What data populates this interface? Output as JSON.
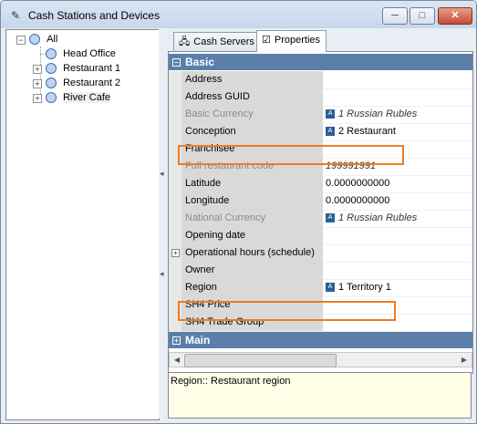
{
  "window": {
    "title": "Cash Stations and Devices",
    "controls": {
      "minimize": "─",
      "maximize": "□",
      "close": "✕"
    }
  },
  "tree": {
    "root": "All",
    "items": [
      "Head Office",
      "Restaurant 1",
      "Restaurant 2",
      "River Cafe"
    ]
  },
  "tabs": [
    {
      "label": "Cash Servers",
      "icon": "server-icon"
    },
    {
      "label": "Properties",
      "icon": "properties-icon"
    }
  ],
  "categories": {
    "basic": "Basic",
    "main": "Main"
  },
  "properties": [
    {
      "name": "Address",
      "value": "",
      "disabled": false
    },
    {
      "name": "Address GUID",
      "value": "",
      "disabled": false
    },
    {
      "name": "Basic Currency",
      "value": "1 Russian Rubles",
      "disabled": true,
      "icon": true,
      "italic": true
    },
    {
      "name": "Conception",
      "value": "2 Restaurant",
      "disabled": false,
      "icon": true
    },
    {
      "name": "Franchisee",
      "value": "",
      "disabled": false
    },
    {
      "name": "Full restaurant code",
      "value": "199991991",
      "disabled": true,
      "italic": true
    },
    {
      "name": "Latitude",
      "value": "0.0000000000",
      "disabled": false
    },
    {
      "name": "Longitude",
      "value": "0.0000000000",
      "disabled": false
    },
    {
      "name": "National Currency",
      "value": "1 Russian Rubles",
      "disabled": true,
      "icon": true,
      "italic": true
    },
    {
      "name": "Opening date",
      "value": "",
      "disabled": false
    },
    {
      "name": "Operational hours (schedule)",
      "value": "",
      "disabled": false,
      "expandable": true
    },
    {
      "name": "Owner",
      "value": "",
      "disabled": false
    },
    {
      "name": "Region",
      "value": "1 Territory 1",
      "disabled": false,
      "icon": true
    },
    {
      "name": "SH4 Price",
      "value": "",
      "disabled": false
    },
    {
      "name": "SH4 Trade Group",
      "value": "",
      "disabled": false
    }
  ],
  "description": "Region:: Restaurant region"
}
